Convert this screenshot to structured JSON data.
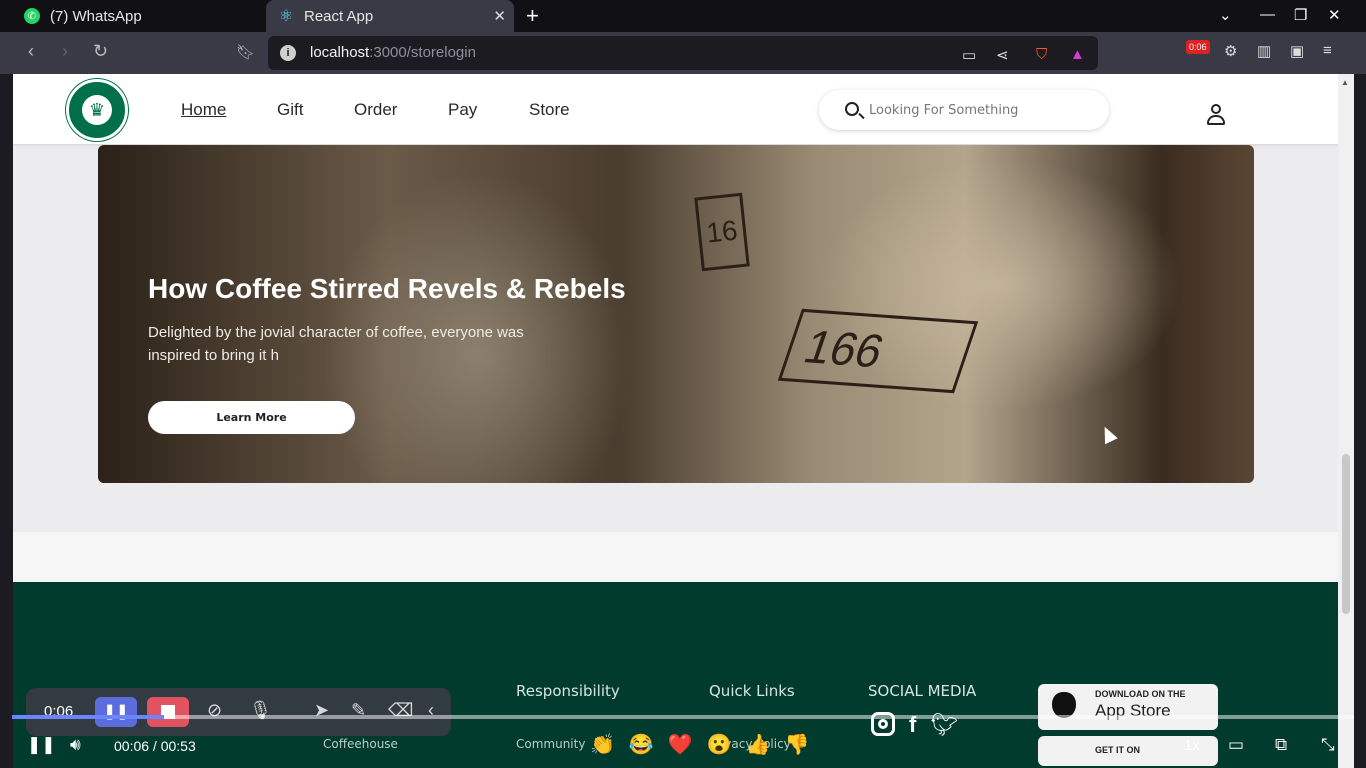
{
  "browser": {
    "tabs": [
      {
        "title": "(7) WhatsApp",
        "active": false
      },
      {
        "title": "React App",
        "active": true
      }
    ],
    "address": {
      "host": "localhost",
      "path": ":3000/storelogin"
    },
    "recording_badge": "0:06"
  },
  "site": {
    "nav": [
      "Home",
      "Gift",
      "Order",
      "Pay",
      "Store"
    ],
    "active_nav": "Home",
    "search_placeholder": "Looking For Something"
  },
  "hero": {
    "title": "How Coffee Stirred Revels & Rebels",
    "description": "Delighted by the jovial character of coffee, everyone was inspired to bring it h",
    "button": "Learn More",
    "bag_label_1": "166",
    "bag_label_2": "16"
  },
  "footer": {
    "headings": [
      "Responsibility",
      "Quick Links",
      "SOCIAL MEDIA"
    ],
    "partial_links": [
      "Coffeehouse",
      "Community",
      "Privacy Policy"
    ],
    "app_store": {
      "small": "DOWNLOAD ON THE",
      "big": "App Store"
    },
    "google_play": {
      "small": "GET IT ON"
    }
  },
  "recorder": {
    "elapsed": "0:06"
  },
  "video": {
    "time": "00:06 / 00:53",
    "progress": 0.113,
    "speed": "1x",
    "reactions": [
      "👏",
      "😂",
      "❤️",
      "😮",
      "👍",
      "👎"
    ]
  },
  "colors": {
    "brand_green": "#00704a",
    "footer_green": "#003b2d",
    "rec_pause": "#5b6cdc",
    "rec_stop": "#e0535f",
    "progress_fill": "#6a85ff"
  }
}
